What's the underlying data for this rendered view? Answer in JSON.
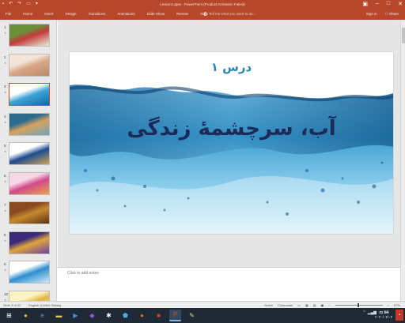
{
  "window": {
    "title": "Lesson1.pptx - PowerPoint (Product Activation Failed)",
    "qat_icons": [
      "save-icon",
      "undo-icon",
      "redo-icon",
      "start-from-beginning-icon",
      "customize-qat-icon"
    ],
    "buttons": [
      "restore-ribbon",
      "minimize",
      "maximize",
      "close"
    ]
  },
  "ribbon": {
    "tabs": [
      "File",
      "Home",
      "Insert",
      "Design",
      "Transitions",
      "Animations",
      "Slide Show",
      "Review",
      "View"
    ],
    "tell_me_placeholder": "Tell me what you want to do...",
    "sign_in": "Sign in",
    "share": "Share"
  },
  "thumbnails": [
    {
      "number": "1",
      "colors": [
        "#6c8f3a",
        "#c43b3b",
        "#e4f0d6"
      ],
      "kind": "flowers"
    },
    {
      "number": "2",
      "colors": [
        "#f3e4d8",
        "#d9a687",
        "#b78a6b"
      ],
      "kind": "paper"
    },
    {
      "number": "3",
      "colors": [
        "#ffffff",
        "#3da3d6",
        "#0d6aa7"
      ],
      "kind": "water",
      "active": true
    },
    {
      "number": "4",
      "colors": [
        "#2c6a8e",
        "#d7a25c",
        "#6aa6c4"
      ],
      "kind": "landscape"
    },
    {
      "number": "5",
      "colors": [
        "#ffffff",
        "#1e4b8f",
        "#cfa45a"
      ],
      "kind": "text"
    },
    {
      "number": "6",
      "colors": [
        "#f7d9e6",
        "#d14a8b",
        "#e8a44d"
      ],
      "kind": "pink"
    },
    {
      "number": "7",
      "colors": [
        "#8a4a1f",
        "#c58a2f",
        "#5c3214"
      ],
      "kind": "brown"
    },
    {
      "number": "8",
      "colors": [
        "#3b2a7a",
        "#e0a43b",
        "#6b3fa3"
      ],
      "kind": "purple"
    },
    {
      "number": "9",
      "colors": [
        "#ffffff",
        "#2d8fd0",
        "#cde9f8"
      ],
      "kind": "ice"
    },
    {
      "number": "10",
      "colors": [
        "#fff4c2",
        "#e0b53b",
        "#ffffff"
      ],
      "kind": "yellow"
    }
  ],
  "slide": {
    "lesson_label": "درس ۱",
    "title": "آب، سرچشمۀ زندگی"
  },
  "notes": {
    "placeholder": "Click to add notes"
  },
  "status": {
    "slide_counter": "Slide 3 of 32",
    "language": "English (United States)",
    "notes": "Notes",
    "comments": "Comments",
    "zoom": "67%"
  },
  "taskbar": {
    "apps": [
      {
        "name": "start",
        "glyph": "⊞",
        "color": "#ffffff"
      },
      {
        "name": "chrome",
        "glyph": "●",
        "color": "#e8b32a"
      },
      {
        "name": "ie",
        "glyph": "e",
        "color": "#3da0e6"
      },
      {
        "name": "explorer",
        "glyph": "▬",
        "color": "#e7c34a"
      },
      {
        "name": "media",
        "glyph": "▶",
        "color": "#4a8ed8"
      },
      {
        "name": "visual-studio",
        "glyph": "◆",
        "color": "#8e5ad8"
      },
      {
        "name": "bluetooth",
        "glyph": "✱",
        "color": "#ffffff"
      },
      {
        "name": "security",
        "glyph": "⬟",
        "color": "#4fb0e0"
      },
      {
        "name": "firefox",
        "glyph": "●",
        "color": "#e66a2a"
      },
      {
        "name": "app-red",
        "glyph": "■",
        "color": "#d23b3b"
      },
      {
        "name": "powerpoint",
        "glyph": "P",
        "color": "#d24726",
        "active": true
      },
      {
        "name": "paint",
        "glyph": "✎",
        "color": "#e0d0a0"
      }
    ],
    "clock_time": "21:56",
    "clock_date": "۲۰۲۰/۰۲/۰۲",
    "lang": "FA"
  }
}
